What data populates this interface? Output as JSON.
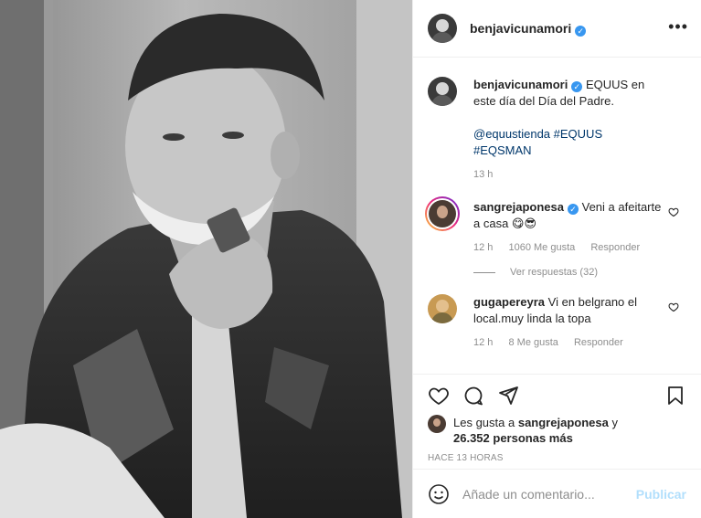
{
  "post": {
    "author": "benjavicunamori",
    "verified_icon": "verified-badge-icon",
    "more_icon": "more-options-icon"
  },
  "caption": {
    "username": "benjavicunamori",
    "text": "EQUUS en este día del Día del Padre.",
    "tags": "@equustienda #EQUUS #EQSMAN",
    "time": "13 h"
  },
  "comments": [
    {
      "username": "sangrejaponesa",
      "verified": true,
      "text": "Veni a afeitarte a casa 😋😎",
      "time": "12 h",
      "likes": "1060 Me gusta",
      "reply_label": "Responder",
      "view_replies": "Ver respuestas (32)"
    },
    {
      "username": "gugapereyra",
      "verified": false,
      "text": "Vi en belgrano el local.muy linda la topa",
      "time": "12 h",
      "likes": "8 Me gusta",
      "reply_label": "Responder"
    }
  ],
  "likes_summary": {
    "prefix": "Les gusta a",
    "user": "sangrejaponesa",
    "connector": "y",
    "others": "26.352 personas más"
  },
  "posted_ago": "HACE 13 HORAS",
  "add_comment": {
    "placeholder": "Añade un comentario...",
    "publish_label": "Publicar"
  },
  "colors": {
    "link": "#00376b",
    "verified": "#3897f0",
    "publish_disabled": "#b2dffc",
    "muted": "#8e8e8e"
  }
}
